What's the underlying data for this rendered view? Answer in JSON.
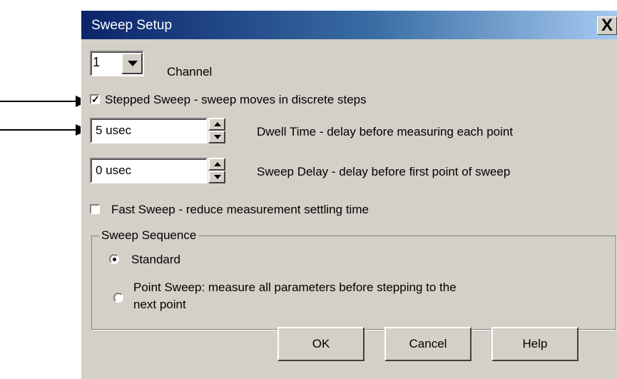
{
  "dialog": {
    "title": "Sweep Setup",
    "close_glyph": "X"
  },
  "channel": {
    "value": "1",
    "label": "Channel"
  },
  "stepped_sweep": {
    "checked": true,
    "check_glyph": "✓",
    "label": "Stepped Sweep - sweep moves in discrete steps"
  },
  "dwell_time": {
    "value": "5 usec",
    "label": "Dwell Time - delay before measuring each point"
  },
  "sweep_delay": {
    "value": "0 usec",
    "label": "Sweep Delay - delay before first point of sweep"
  },
  "fast_sweep": {
    "checked": false,
    "label": "Fast Sweep - reduce measurement settling time"
  },
  "sweep_sequence": {
    "title": "Sweep Sequence",
    "options": [
      {
        "label": "Standard",
        "selected": true
      },
      {
        "label_line1": "Point Sweep: measure all parameters before stepping to the",
        "label_line2": "next point",
        "selected": false
      }
    ]
  },
  "buttons": {
    "ok": "OK",
    "cancel": "Cancel",
    "help": "Help"
  }
}
